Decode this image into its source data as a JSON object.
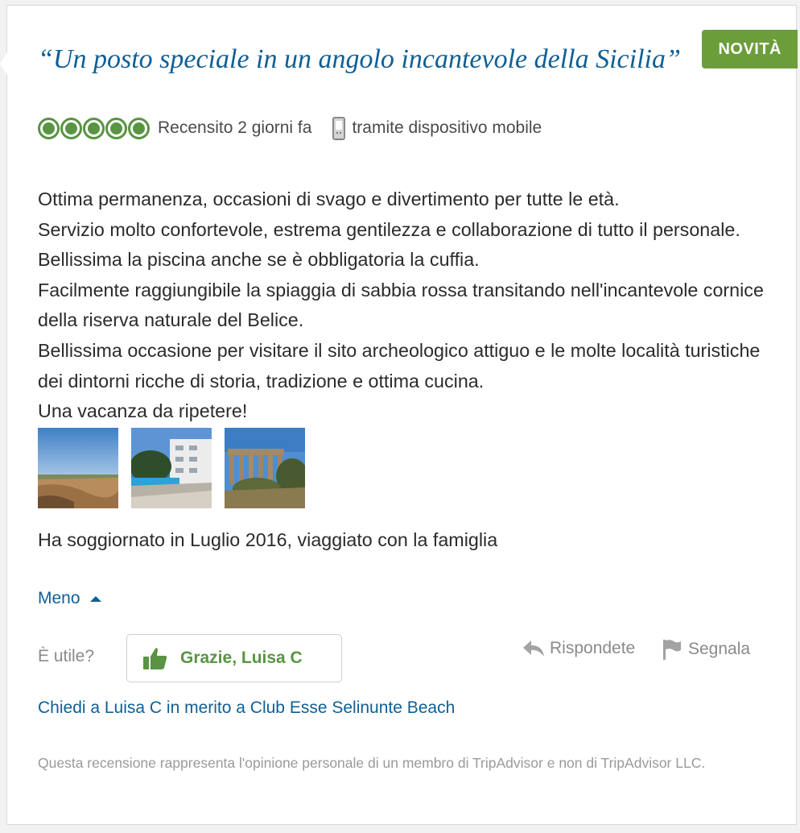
{
  "review": {
    "badge": "NOVITÀ",
    "title": "“Un posto speciale in un angolo incantevole della Sicilia”",
    "rating": 5,
    "reviewed_when": "Recensito 2 giorni fa",
    "via": "tramite dispositivo mobile",
    "body": "Ottima permanenza, occasioni di svago e divertimento per tutte le età.\nServizio molto confortevole, estrema gentilezza e collaborazione di tutto il personale. Bellissima la piscina anche se è obbligatoria la cuffia.\nFacilmente raggiungibile la spiaggia di sabbia rossa transitando nell'incantevole cornice della riserva naturale del Belice.\nBellissima occasione per visitare il sito archeologico attiguo e le molte località turistiche dei dintorni ricche di storia, tradizione e ottima cucina.\nUna vacanza da ripetere!",
    "photos": [
      "beach-dunes-photo",
      "hotel-building-photo",
      "greek-temple-photo"
    ],
    "stay": "Ha soggiornato in Luglio 2016, viaggiato con la famiglia",
    "less_link": "Meno"
  },
  "actions": {
    "helpful_label": "È utile?",
    "thanks_button": "Grazie, Luisa C",
    "reply": "Rispondete",
    "flag": "Segnala",
    "ask_link": "Chiedi a Luisa C in merito a Club Esse Selinunte Beach"
  },
  "disclaimer": "Questa recensione rappresenta l'opinione personale di un membro di TripAdvisor e non di TripAdvisor LLC.",
  "colors": {
    "link": "#0f5f95",
    "rating_green": "#589442",
    "badge_green": "#6b9e3b",
    "muted": "#8a8a8a"
  }
}
